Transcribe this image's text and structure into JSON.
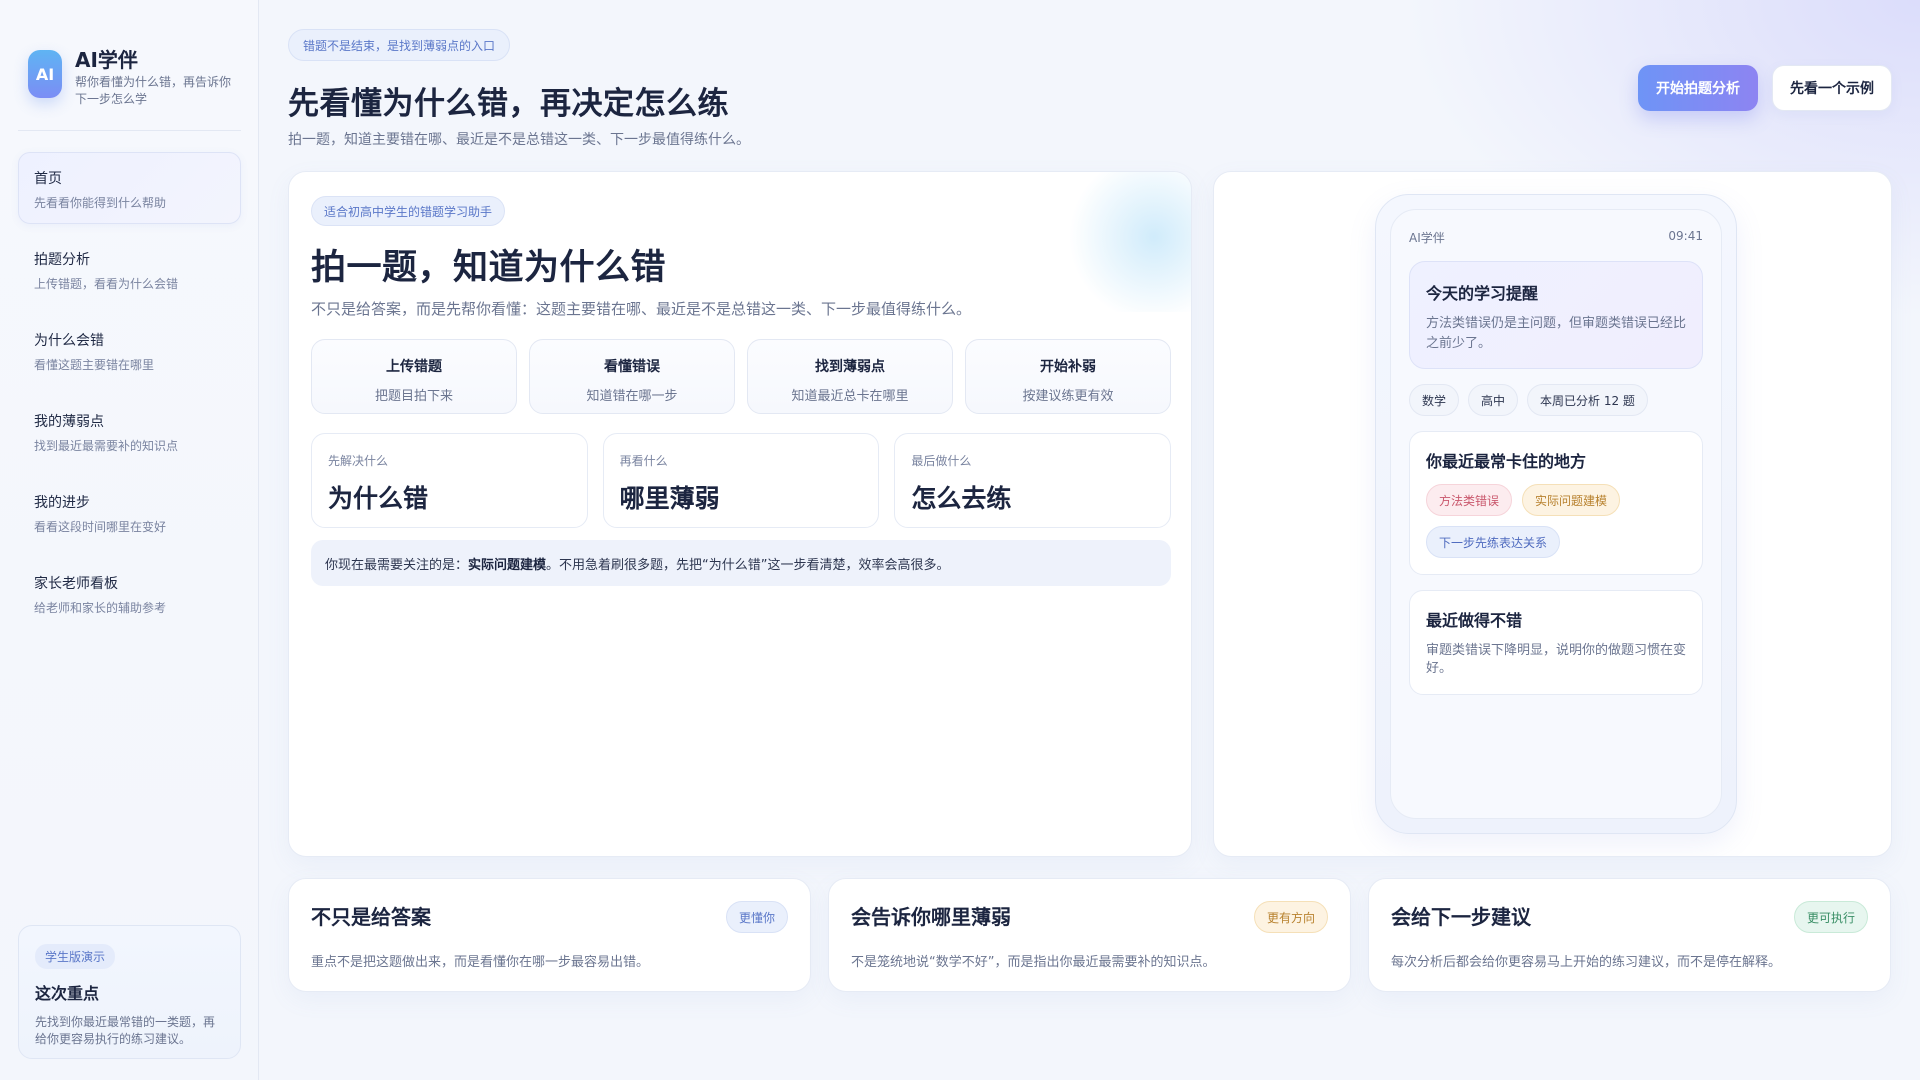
{
  "brand": {
    "logo_text": "AI",
    "name": "AI学伴",
    "description": "帮你看懂为什么错，再告诉你下一步怎么学"
  },
  "nav": {
    "items": [
      {
        "title": "首页",
        "subtitle": "先看看你能得到什么帮助",
        "active": true
      },
      {
        "title": "拍题分析",
        "subtitle": "上传错题，看看为什么会错",
        "active": false
      },
      {
        "title": "为什么会错",
        "subtitle": "看懂这题主要错在哪里",
        "active": false
      },
      {
        "title": "我的薄弱点",
        "subtitle": "找到最近最需要补的知识点",
        "active": false
      },
      {
        "title": "我的进步",
        "subtitle": "看看这段时间哪里在变好",
        "active": false
      },
      {
        "title": "家长老师看板",
        "subtitle": "给老师和家长的辅助参考",
        "active": false
      }
    ]
  },
  "side_card": {
    "badge": "学生版演示",
    "title": "这次重点",
    "description": "先找到你最近最常错的一类题，再给你更容易执行的练习建议。"
  },
  "header": {
    "tag": "错题不是结束，是找到薄弱点的入口",
    "title": "先看懂为什么错，再决定怎么练",
    "subtitle": "拍一题，知道主要错在哪、最近是不是总错这一类、下一步最值得练什么。",
    "primary_button": "开始拍题分析",
    "secondary_button": "先看一个示例"
  },
  "main_card": {
    "tag": "适合初高中学生的错题学习助手",
    "title": "拍一题，知道为什么错",
    "subtitle": "不只是给答案，而是先帮你看懂：这题主要错在哪、最近是不是总错这一类、下一步最值得练什么。",
    "steps": [
      {
        "title": "上传错题",
        "subtitle": "把题目拍下来"
      },
      {
        "title": "看懂错误",
        "subtitle": "知道错在哪一步"
      },
      {
        "title": "找到薄弱点",
        "subtitle": "知道最近总卡在哪里"
      },
      {
        "title": "开始补弱",
        "subtitle": "按建议练更有效"
      }
    ],
    "phases": [
      {
        "label": "先解决什么",
        "value": "为什么错"
      },
      {
        "label": "再看什么",
        "value": "哪里薄弱"
      },
      {
        "label": "最后做什么",
        "value": "怎么去练"
      }
    ],
    "focus": {
      "prefix": "你现在最需要关注的是：",
      "highlight": "实际问题建模",
      "suffix": "。不用急着刷很多题，先把“为什么错”这一步看清楚，效率会高很多。"
    }
  },
  "phone": {
    "app_name": "AI学伴",
    "time": "09:41",
    "reminder": {
      "title": "今天的学习提醒",
      "text": "方法类错误仍是主问题，但审题类错误已经比之前少了。"
    },
    "chips": [
      "数学",
      "高中",
      "本周已分析 12 题"
    ],
    "stuck": {
      "title": "你最近最常卡住的地方",
      "tags": [
        "方法类错误",
        "实际问题建模",
        "下一步先练表达关系"
      ]
    },
    "good": {
      "title": "最近做得不错",
      "text": "审题类错误下降明显，说明你的做题习惯在变好。"
    }
  },
  "features": [
    {
      "title": "不只是给答案",
      "badge": "更懂你",
      "description": "重点不是把这题做出来，而是看懂你在哪一步最容易出错。"
    },
    {
      "title": "会告诉你哪里薄弱",
      "badge": "更有方向",
      "description": "不是笼统地说“数学不好”，而是指出你最近最需要补的知识点。"
    },
    {
      "title": "会给下一步建议",
      "badge": "更可执行",
      "description": "每次分析后都会给你更容易马上开始的练习建议，而不是停在解释。"
    }
  ]
}
